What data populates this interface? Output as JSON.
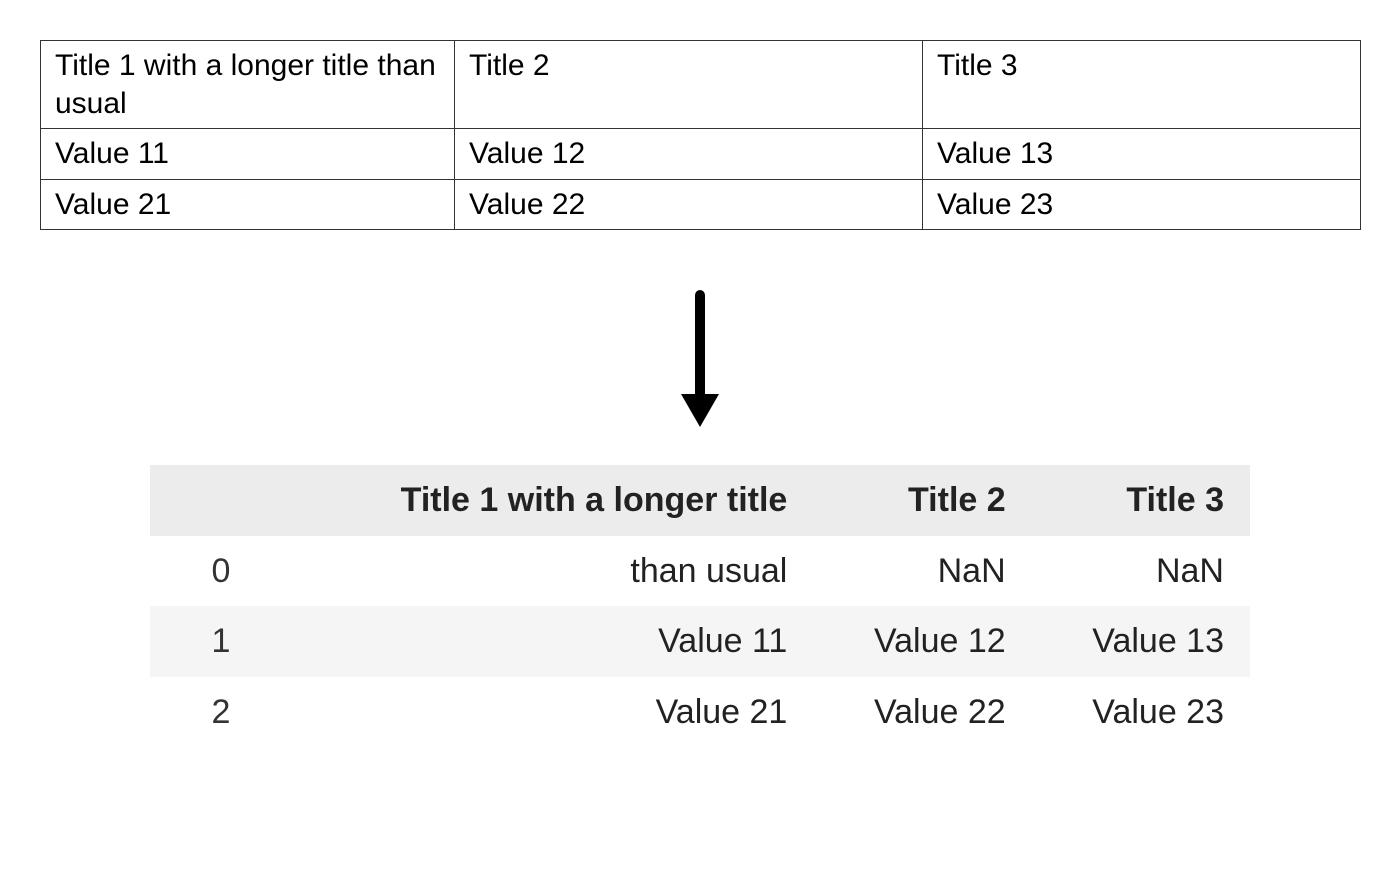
{
  "source_table": {
    "headers": [
      "Title 1 with a longer title than usual",
      "Title 2",
      "Title 3"
    ],
    "rows": [
      [
        "Value 11",
        "Value 12",
        "Value 13"
      ],
      [
        "Value 21",
        "Value 22",
        "Value 23"
      ]
    ]
  },
  "dataframe": {
    "columns": [
      "Title 1 with a longer title",
      "Title 2",
      "Title 3"
    ],
    "index": [
      "0",
      "1",
      "2"
    ],
    "rows": [
      [
        "than usual",
        "NaN",
        "NaN"
      ],
      [
        "Value 11",
        "Value 12",
        "Value 13"
      ],
      [
        "Value 21",
        "Value 22",
        "Value 23"
      ]
    ]
  }
}
